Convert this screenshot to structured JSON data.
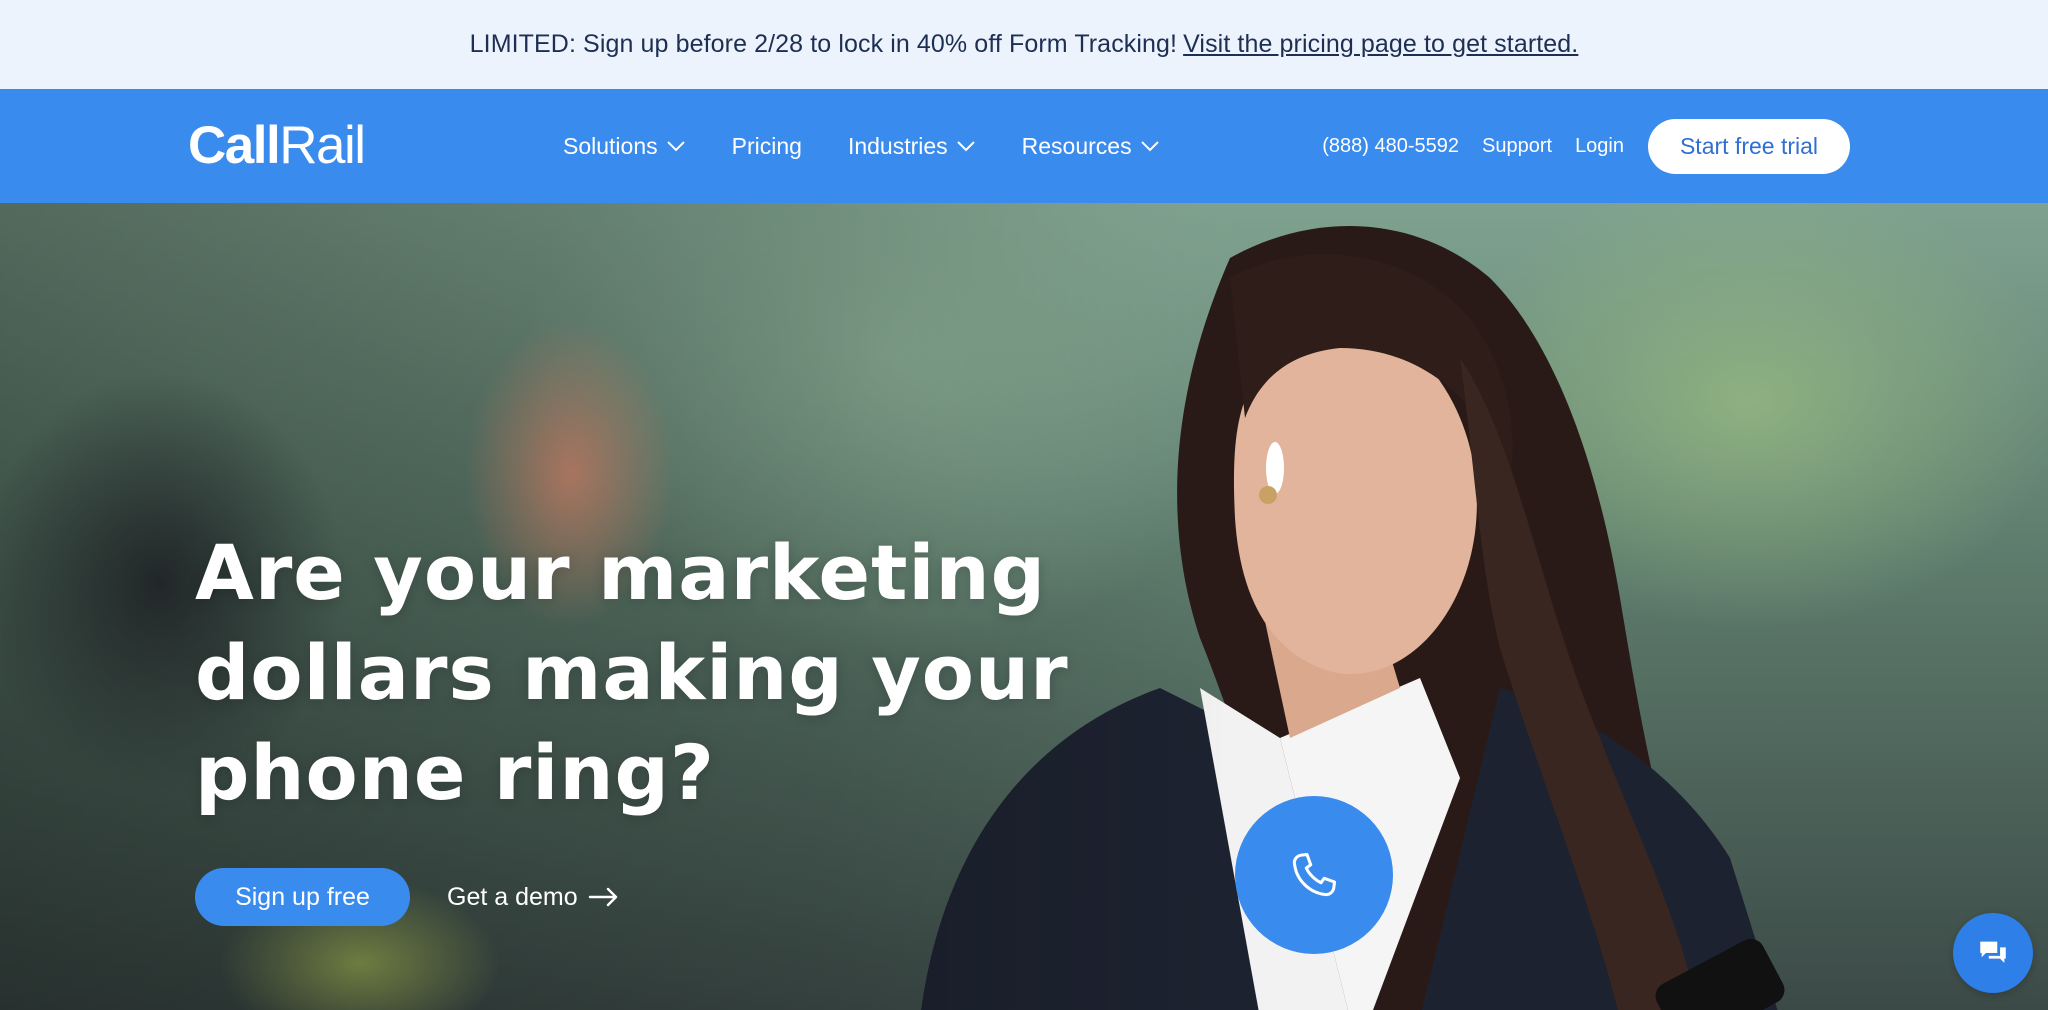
{
  "promo": {
    "text": "LIMITED: Sign up before 2/28 to lock in 40% off Form Tracking!",
    "link_text": "Visit the pricing page to get started."
  },
  "nav": {
    "logo_bold": "Call",
    "logo_light": "Rail",
    "items": [
      {
        "label": "Solutions",
        "has_dropdown": true
      },
      {
        "label": "Pricing",
        "has_dropdown": false
      },
      {
        "label": "Industries",
        "has_dropdown": true
      },
      {
        "label": "Resources",
        "has_dropdown": true
      }
    ],
    "phone": "(888) 480-5592",
    "support": "Support",
    "login": "Login",
    "cta": "Start free trial"
  },
  "hero": {
    "headline_line1": "Are your marketing",
    "headline_line2": "dollars making your",
    "headline_line3": "phone ring?",
    "primary_cta": "Sign up free",
    "secondary_cta": "Get a demo"
  },
  "colors": {
    "brand_blue": "#3a8bee",
    "banner_bg": "#edf3fd",
    "banner_text": "#1d2f52"
  },
  "icons": {
    "dropdown": "chevron-down-icon",
    "demo_arrow": "arrow-right-icon",
    "call": "phone-icon",
    "chat": "chat-icon"
  }
}
